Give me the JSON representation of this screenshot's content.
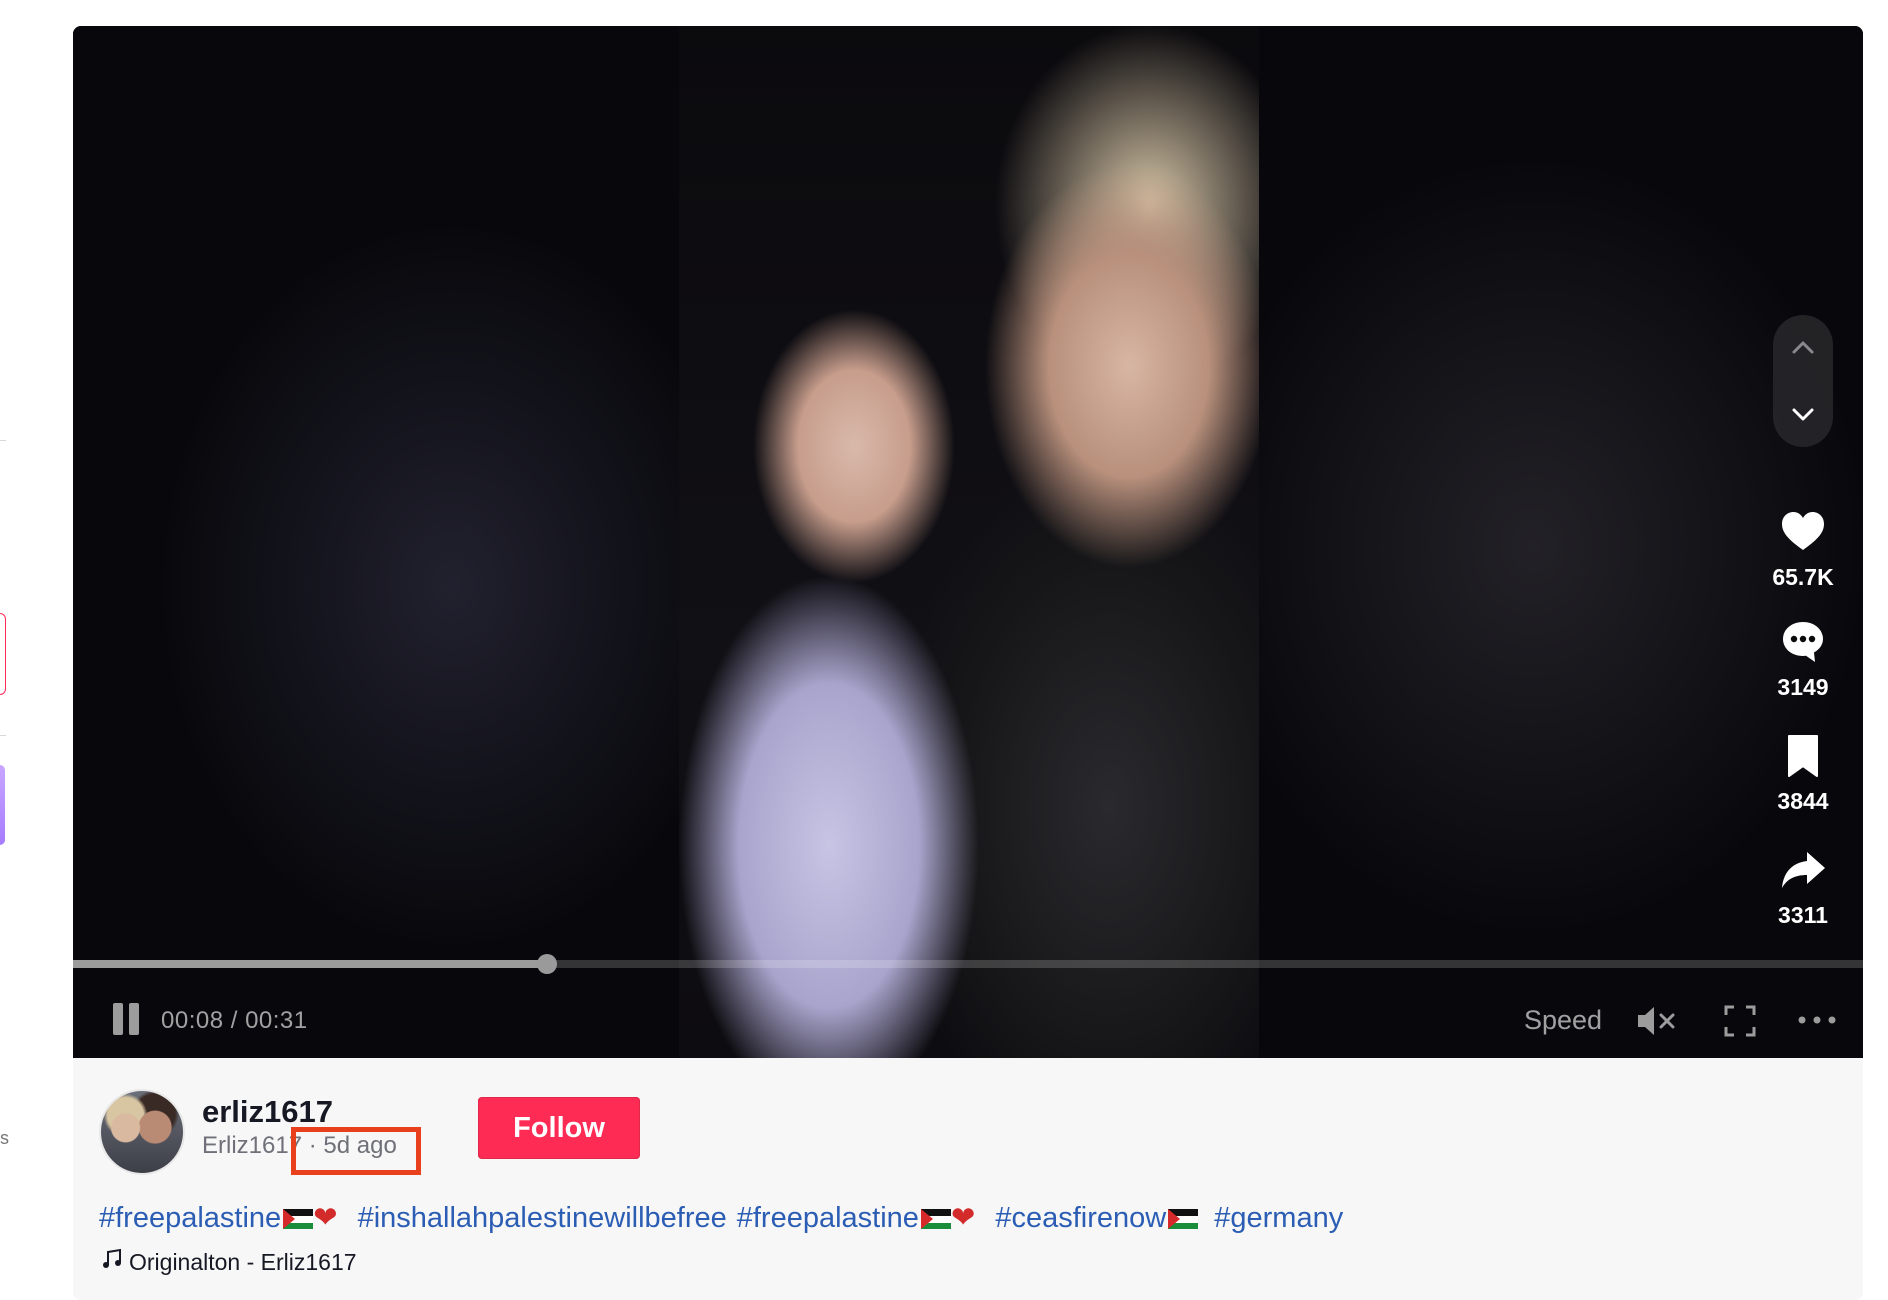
{
  "player": {
    "elapsed": "00:08",
    "duration": "00:31",
    "time_label": "00:08 / 00:31",
    "progress": 0.265,
    "speed_label": "Speed",
    "muted": true
  },
  "actions": {
    "likes": "65.7K",
    "comments": "3149",
    "saves": "3844",
    "shares": "3311"
  },
  "author": {
    "username": "erliz1617",
    "nickname": "Erliz1617",
    "posted": "· 5d ago",
    "follow_label": "Follow"
  },
  "caption": {
    "tags": [
      "#freepalastine",
      "#inshallahpalestinewillbefree",
      "#freepalastine",
      "#ceasfirenow",
      "#germany"
    ]
  },
  "music": {
    "label": "Originalton - Erliz1617"
  },
  "colors": {
    "accent": "#fe2c55",
    "hashtag": "#2b5db4",
    "highlight_box": "#e8401c"
  },
  "icons": [
    "pause-icon",
    "mute-icon",
    "fullscreen-icon",
    "more-icon",
    "chevron-up-icon",
    "chevron-down-icon",
    "heart-icon",
    "comment-icon",
    "bookmark-icon",
    "share-icon",
    "music-note-icon"
  ]
}
